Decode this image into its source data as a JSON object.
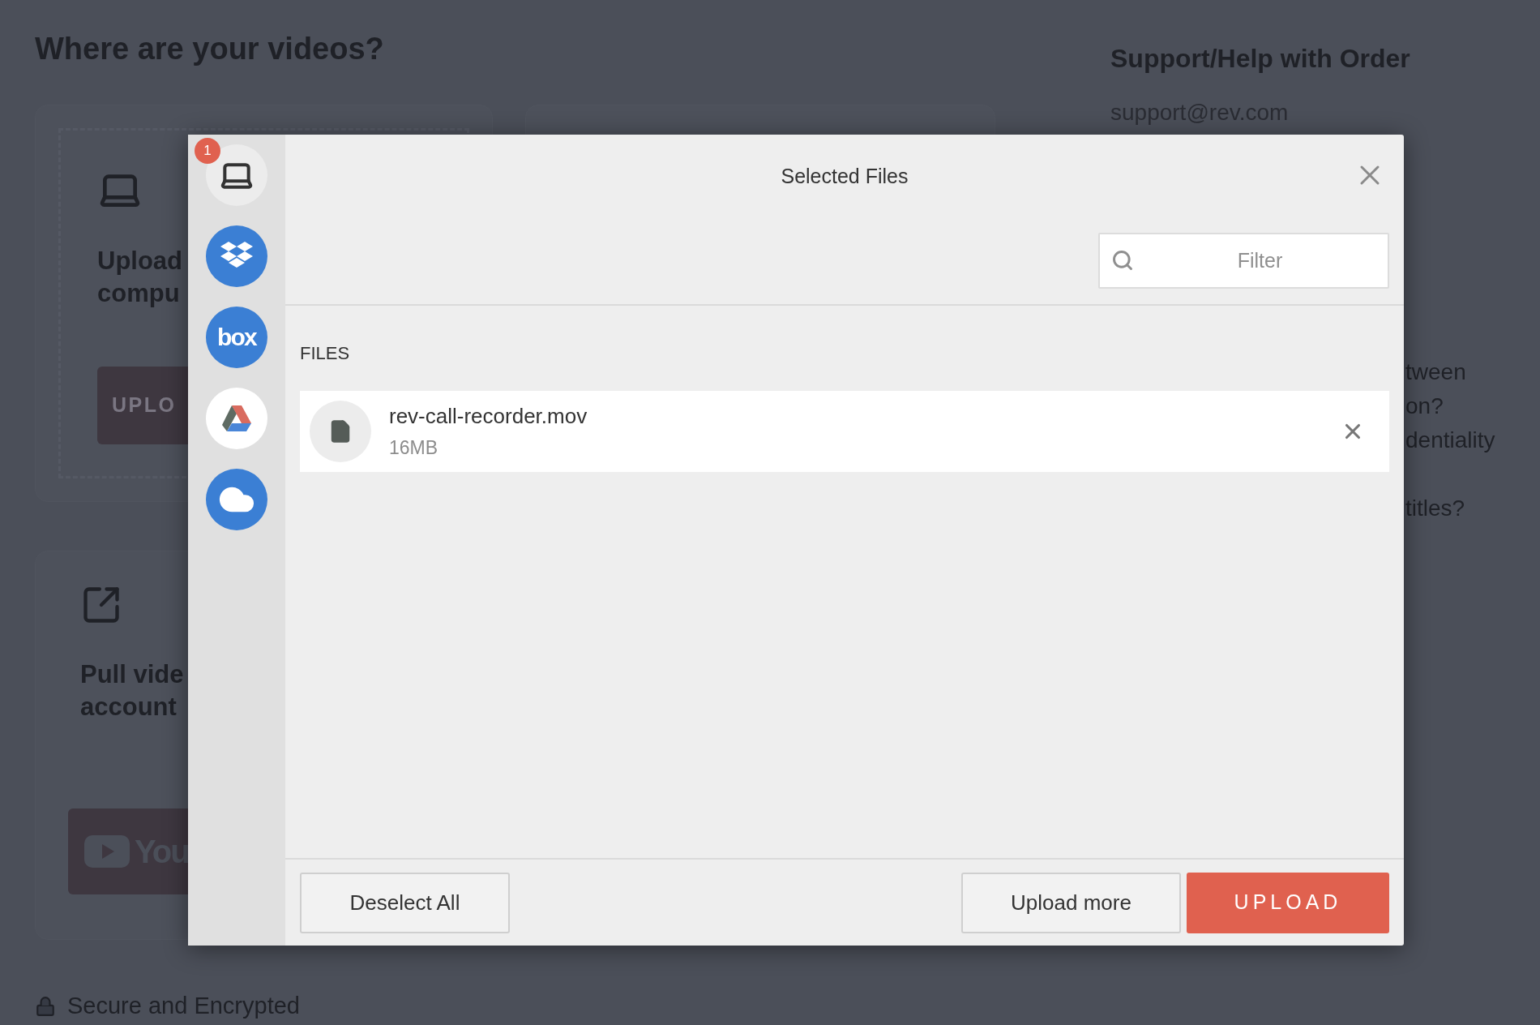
{
  "background": {
    "heading": "Where are your videos?",
    "computer_card": {
      "title_lines": [
        "Upload",
        "compu"
      ],
      "button": "UPLO"
    },
    "account_card": {
      "title_lines": [
        "Pull vide",
        "account"
      ],
      "button_logo": "You"
    },
    "secure_note": "Secure and Encrypted",
    "support": {
      "heading": "Support/Help with Order",
      "email": "support@rev.com",
      "faq_fragments": [
        "tween",
        "on?",
        "dentiality",
        "titles?"
      ]
    }
  },
  "dialog": {
    "title": "Selected Files",
    "sources": [
      {
        "kind": "computer",
        "badge": "1"
      },
      {
        "kind": "dropbox"
      },
      {
        "kind": "box",
        "label": "box"
      },
      {
        "kind": "drive"
      },
      {
        "kind": "cloud"
      }
    ],
    "filter": {
      "placeholder": "Filter"
    },
    "section": "FILES",
    "files": [
      {
        "name": "rev-call-recorder.mov",
        "size": "16MB"
      }
    ],
    "buttons": {
      "deselect": "Deselect All",
      "more": "Upload more",
      "upload": "UPLOAD"
    }
  }
}
